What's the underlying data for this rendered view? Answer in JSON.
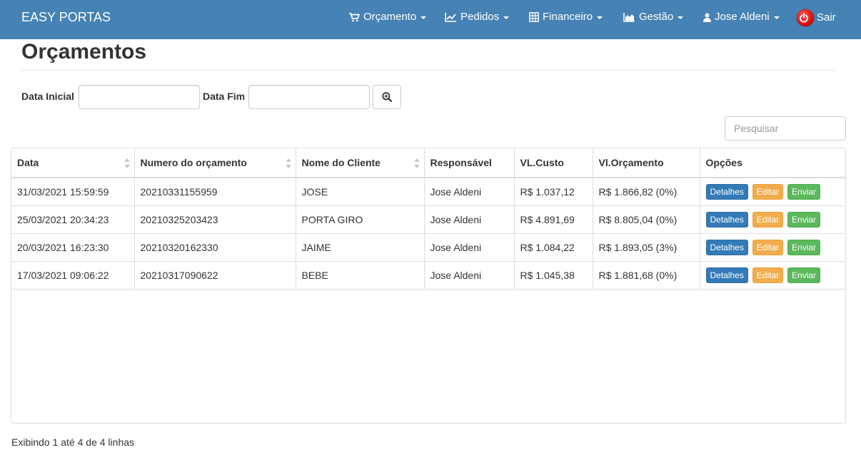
{
  "navbar": {
    "brand": "EASY PORTAS",
    "items": [
      {
        "label": "Orçamento",
        "icon": "cart-icon"
      },
      {
        "label": "Pedidos",
        "icon": "line-chart-icon"
      },
      {
        "label": "Financeiro",
        "icon": "calculator-icon"
      },
      {
        "label": "Gestão",
        "icon": "area-chart-icon"
      },
      {
        "label": "Jose Aldeni",
        "icon": "user-icon"
      }
    ],
    "logout": {
      "label": "Sair",
      "icon": "power-icon"
    }
  },
  "page": {
    "title": "Orçamentos"
  },
  "filters": {
    "start_label": "Data Inicial",
    "start_value": "",
    "end_label": "Data Fim",
    "end_value": "",
    "search_button_icon": "zoom-in-icon"
  },
  "search": {
    "placeholder": "Pesquisar"
  },
  "table": {
    "columns": [
      "Data",
      "Numero do orçamento",
      "Nome do Cliente",
      "Responsável",
      "VL.Custo",
      "Vl.Orçamento",
      "Opções"
    ],
    "rows": [
      {
        "data": "31/03/2021 15:59:59",
        "numero": "20210331155959",
        "cliente": "JOSE",
        "responsavel": "Jose Aldeni",
        "custo": "R$ 1.037,12",
        "orcamento": "R$ 1.866,82 (0%)"
      },
      {
        "data": "25/03/2021 20:34:23",
        "numero": "20210325203423",
        "cliente": "PORTA GIRO",
        "responsavel": "Jose Aldeni",
        "custo": "R$ 4.891,69",
        "orcamento": "R$ 8.805,04 (0%)"
      },
      {
        "data": "20/03/2021 16:23:30",
        "numero": "20210320162330",
        "cliente": "JAIME",
        "responsavel": "Jose Aldeni",
        "custo": "R$ 1.084,22",
        "orcamento": "R$ 1.893,05 (3%)"
      },
      {
        "data": "17/03/2021 09:06:22",
        "numero": "20210317090622",
        "cliente": "BEBE",
        "responsavel": "Jose Aldeni",
        "custo": "R$ 1.045,38",
        "orcamento": "R$ 1.881,68 (0%)"
      }
    ],
    "actions": {
      "details": "Detalhes",
      "edit": "Editar",
      "send": "Enviar"
    }
  },
  "pagination": {
    "info": "Exibindo 1 até 4 de 4 linhas"
  },
  "colors": {
    "navbar": "#4682b4",
    "primary": "#337ab7",
    "warning": "#f0ad4e",
    "success": "#5cb85c"
  }
}
